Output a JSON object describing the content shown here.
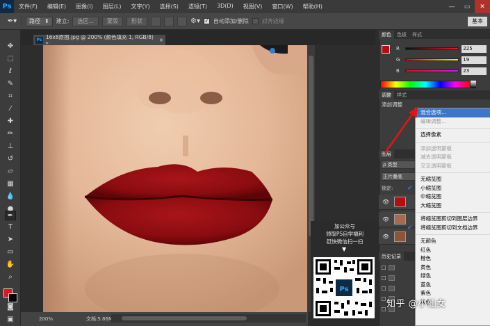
{
  "app": {
    "logo": "Ps"
  },
  "menubar": {
    "items": [
      "文件(F)",
      "编辑(E)",
      "图像(I)",
      "图层(L)",
      "文字(Y)",
      "选择(S)",
      "滤镜(T)",
      "3D(D)",
      "视图(V)",
      "窗口(W)",
      "帮助(H)"
    ],
    "minimize": "—",
    "restore": "▭",
    "close": "✕"
  },
  "options": {
    "tool_mode": "路径",
    "build_label": "建立:",
    "selection_btn": "选区...",
    "mask_btn": "蒙版",
    "shape_btn": "形状",
    "auto_add_delete": "自动添加/删除",
    "align_edges": "对齐边缘",
    "workspace": "基本"
  },
  "document": {
    "tab_title": "16x8原图.jpg @ 200% (颜色填充 1, RGB/8) *",
    "zoom": "200%",
    "doc_info": "文档:5.86M/12.0M"
  },
  "panels": {
    "color_tabs": [
      "颜色",
      "色板",
      "样式"
    ],
    "color": {
      "r_label": "R",
      "r_value": "225",
      "g_label": "G",
      "g_value": "19",
      "b_label": "B",
      "b_value": "23",
      "swatch_hex": "#e11317"
    },
    "adjust_tabs": [
      "调整",
      "样式"
    ],
    "adjust_title": "添加调整",
    "layers_tab": "图层",
    "layers_filter": "ρ 类型",
    "blend_mode": "正片叠底",
    "lock_label": "锁定:",
    "history_tab": "历史记录"
  },
  "context_menu": {
    "items": [
      {
        "label": "混合选项...",
        "state": "highlighted"
      },
      {
        "label": "编辑调整...",
        "state": "disabled"
      },
      {
        "sep": true
      },
      {
        "label": "选择像素",
        "state": "normal"
      },
      {
        "sep": true
      },
      {
        "label": "添加透明蒙板",
        "state": "disabled"
      },
      {
        "label": "减去透明蒙板",
        "state": "disabled"
      },
      {
        "label": "交叉透明蒙板",
        "state": "disabled"
      },
      {
        "sep": true
      },
      {
        "label": "无缩览图",
        "state": "normal"
      },
      {
        "label": "小缩览图",
        "state": "checked"
      },
      {
        "label": "中缩览图",
        "state": "normal"
      },
      {
        "label": "大缩览图",
        "state": "normal"
      },
      {
        "sep": true
      },
      {
        "label": "将缩览图剪切到图层边界",
        "state": "normal"
      },
      {
        "label": "将缩览图剪切到文档边界",
        "state": "checked"
      },
      {
        "sep": true
      },
      {
        "label": "无颜色",
        "state": "normal"
      },
      {
        "label": "红色",
        "state": "normal"
      },
      {
        "label": "橙色",
        "state": "normal"
      },
      {
        "label": "黄色",
        "state": "normal"
      },
      {
        "label": "绿色",
        "state": "normal"
      },
      {
        "label": "蓝色",
        "state": "normal"
      },
      {
        "label": "紫色",
        "state": "normal"
      },
      {
        "label": "灰色",
        "state": "normal"
      }
    ]
  },
  "promo": {
    "line1": "加公众号",
    "line2": "领取PS自学福利",
    "line3": "赶快微信扫一扫",
    "arrow": "▼",
    "qr_logo": "Ps"
  },
  "watermark": "知乎 @小仙女"
}
